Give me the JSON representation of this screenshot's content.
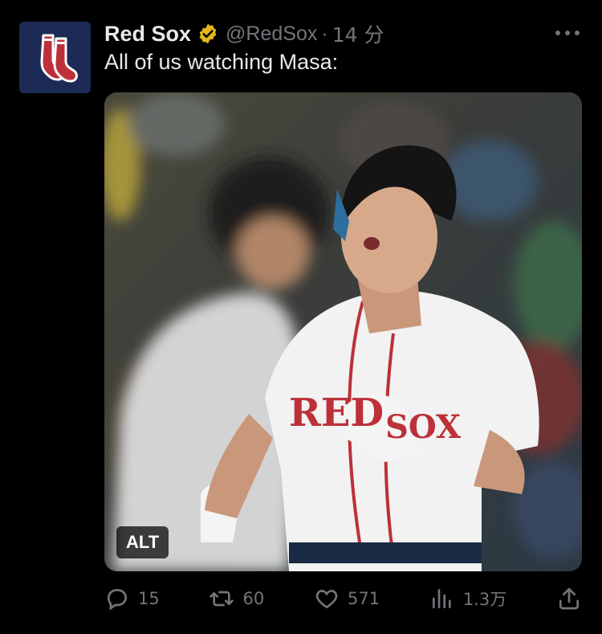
{
  "tweet": {
    "author_name": "Red Sox",
    "handle": "@RedSox",
    "separator": "·",
    "time": "14 分",
    "text": "All of us watching Masa:",
    "media": {
      "alt_badge": "ALT"
    },
    "actions": {
      "replies": "15",
      "retweets": "60",
      "likes": "571",
      "views": "1.3万"
    }
  },
  "colors": {
    "background": "#000000",
    "text": "#e7e9ea",
    "secondary": "#71767b",
    "verified_badge": "#e2b719",
    "avatar_bg": "#1d2a55",
    "logo_red": "#bd3039"
  }
}
